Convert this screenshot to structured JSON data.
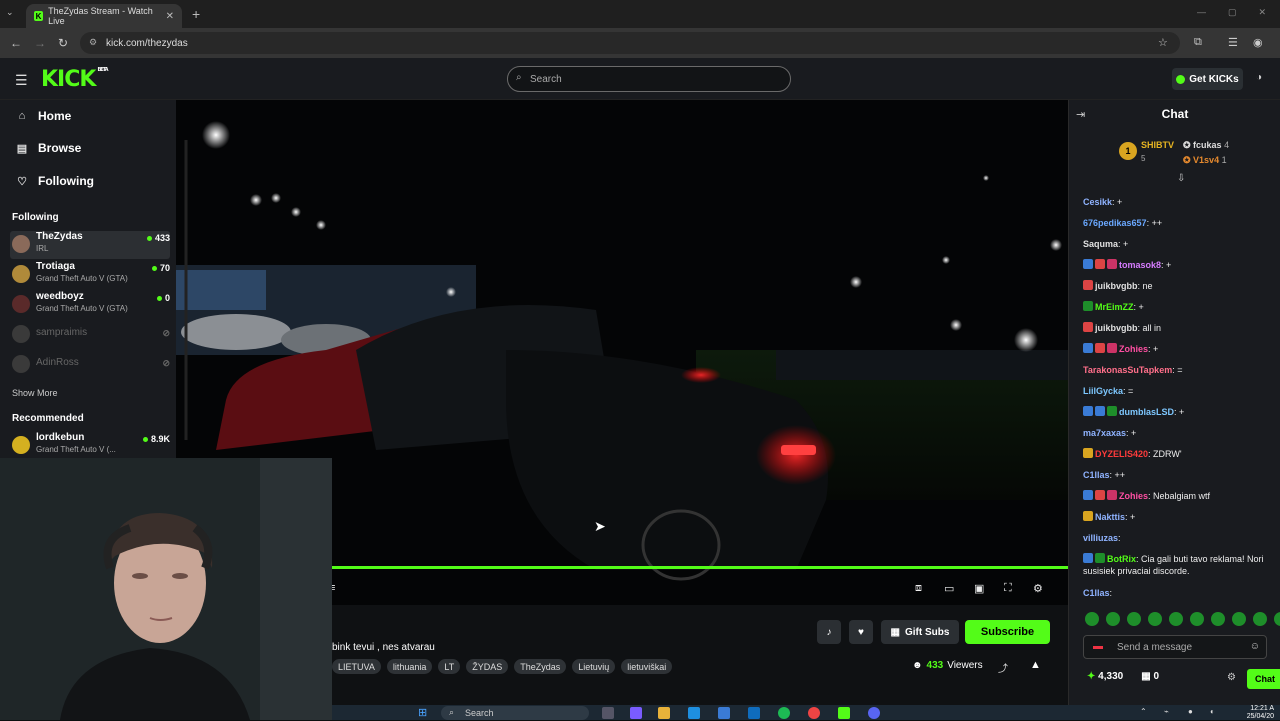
{
  "browser": {
    "tab_title": "TheZydas Stream - Watch Live",
    "tab_icon": "K",
    "new_tab": "+",
    "url": "kick.com/thezydas"
  },
  "header": {
    "logo": "KICK",
    "logo_sup": "BETA",
    "search_placeholder": "Search",
    "get_kicks": "Get KICKs"
  },
  "sidebar": {
    "nav": [
      {
        "label": "Home",
        "icon": "home-icon"
      },
      {
        "label": "Browse",
        "icon": "browse-icon"
      },
      {
        "label": "Following",
        "icon": "heart-icon"
      }
    ],
    "following_title": "Following",
    "following": [
      {
        "name": "TheZydas",
        "category": "IRL",
        "viewers": "433"
      },
      {
        "name": "Trotiaga",
        "category": "Grand Theft Auto V (GTA)",
        "viewers": "70"
      },
      {
        "name": "weedboyz",
        "category": "Grand Theft Auto V (GTA)",
        "viewers": "0"
      },
      {
        "name": "sampraimis",
        "category": "",
        "viewers": ""
      },
      {
        "name": "AdinRoss",
        "category": "",
        "viewers": ""
      }
    ],
    "show_more": "Show More",
    "recommended_title": "Recommended",
    "recommended": [
      {
        "name": "lordkebun",
        "category": "Grand Theft Auto V (...",
        "viewers": "8.9K"
      }
    ]
  },
  "stream": {
    "progress_fraction": 1.0,
    "title": "bink tevui , nes atvarau",
    "tags": [
      "LIETUVA",
      "lithuania",
      "LT",
      "ŽYDAS",
      "TheZydas",
      "Lietuvių",
      "lietuviškai"
    ],
    "gift_subs": "Gift Subs",
    "subscribe": "Subscribe",
    "viewers_count": "433",
    "viewers_label": "Viewers"
  },
  "chat": {
    "title": "Chat",
    "pinned": {
      "rank": "1",
      "left_user": "SHIBTV",
      "left_count": "5",
      "right": [
        {
          "user": "fcukas",
          "count": "4"
        },
        {
          "user": "V1sv4",
          "count": "1"
        }
      ]
    },
    "messages": [
      {
        "user": "Cesikk",
        "color": "#8fb3ff",
        "text": ": +"
      },
      {
        "user": "676pedikas657",
        "color": "#6aa8ff",
        "text": ": ++"
      },
      {
        "user": "Saquma",
        "color": "#e0e0e0",
        "text": ": +"
      },
      {
        "user": "tomasok8",
        "color": "#d67cff",
        "text": ": +"
      },
      {
        "user": "juikbvgbb",
        "color": "#e0e0e0",
        "text": ": ne"
      },
      {
        "user": "MrEimZZ",
        "color": "#53fc18",
        "text": ": +"
      },
      {
        "user": "juikbvgbb",
        "color": "#e0e0e0",
        "text": ": all in"
      },
      {
        "user": "Zohies",
        "color": "#ff4fa3",
        "text": ": +"
      },
      {
        "user": "TarakonasSuTapkem",
        "color": "#ff6f8a",
        "text": ": ="
      },
      {
        "user": "LiilGycka",
        "color": "#7ec8ff",
        "text": ": ="
      },
      {
        "user": "dumblasLSD",
        "color": "#7ec8ff",
        "text": ": +"
      },
      {
        "user": "ma7xaxas",
        "color": "#8fb3ff",
        "text": ": +"
      },
      {
        "user": "DYZELIS420",
        "color": "#ff3b3b",
        "text": ": ZDRW'"
      },
      {
        "user": "C1llas",
        "color": "#8fb3ff",
        "text": ": ++"
      },
      {
        "user": "Zohies",
        "color": "#ff4fa3",
        "text": ": Nebalgiam wtf"
      },
      {
        "user": "Nakttis",
        "color": "#8fb3ff",
        "text": ": +"
      },
      {
        "user": "villiuzas",
        "color": "#8fb3ff",
        "text": ":"
      },
      {
        "user": "BotRix",
        "color": "#53fc18",
        "text": ": Cia gali buti tavo reklama! Nori susisiek privaciai discorde."
      },
      {
        "user": "C1llas",
        "color": "#8fb3ff",
        "text": ":"
      }
    ],
    "input_placeholder": "Send a message",
    "points": "4,330",
    "gifts": "0",
    "send": "Chat"
  },
  "taskbar": {
    "search": "Search",
    "time": "12:21 A",
    "date": "25/04/20"
  },
  "colors": {
    "accent": "#53fc18",
    "bg": "#0b0e0f",
    "panel": "#191b1f"
  }
}
